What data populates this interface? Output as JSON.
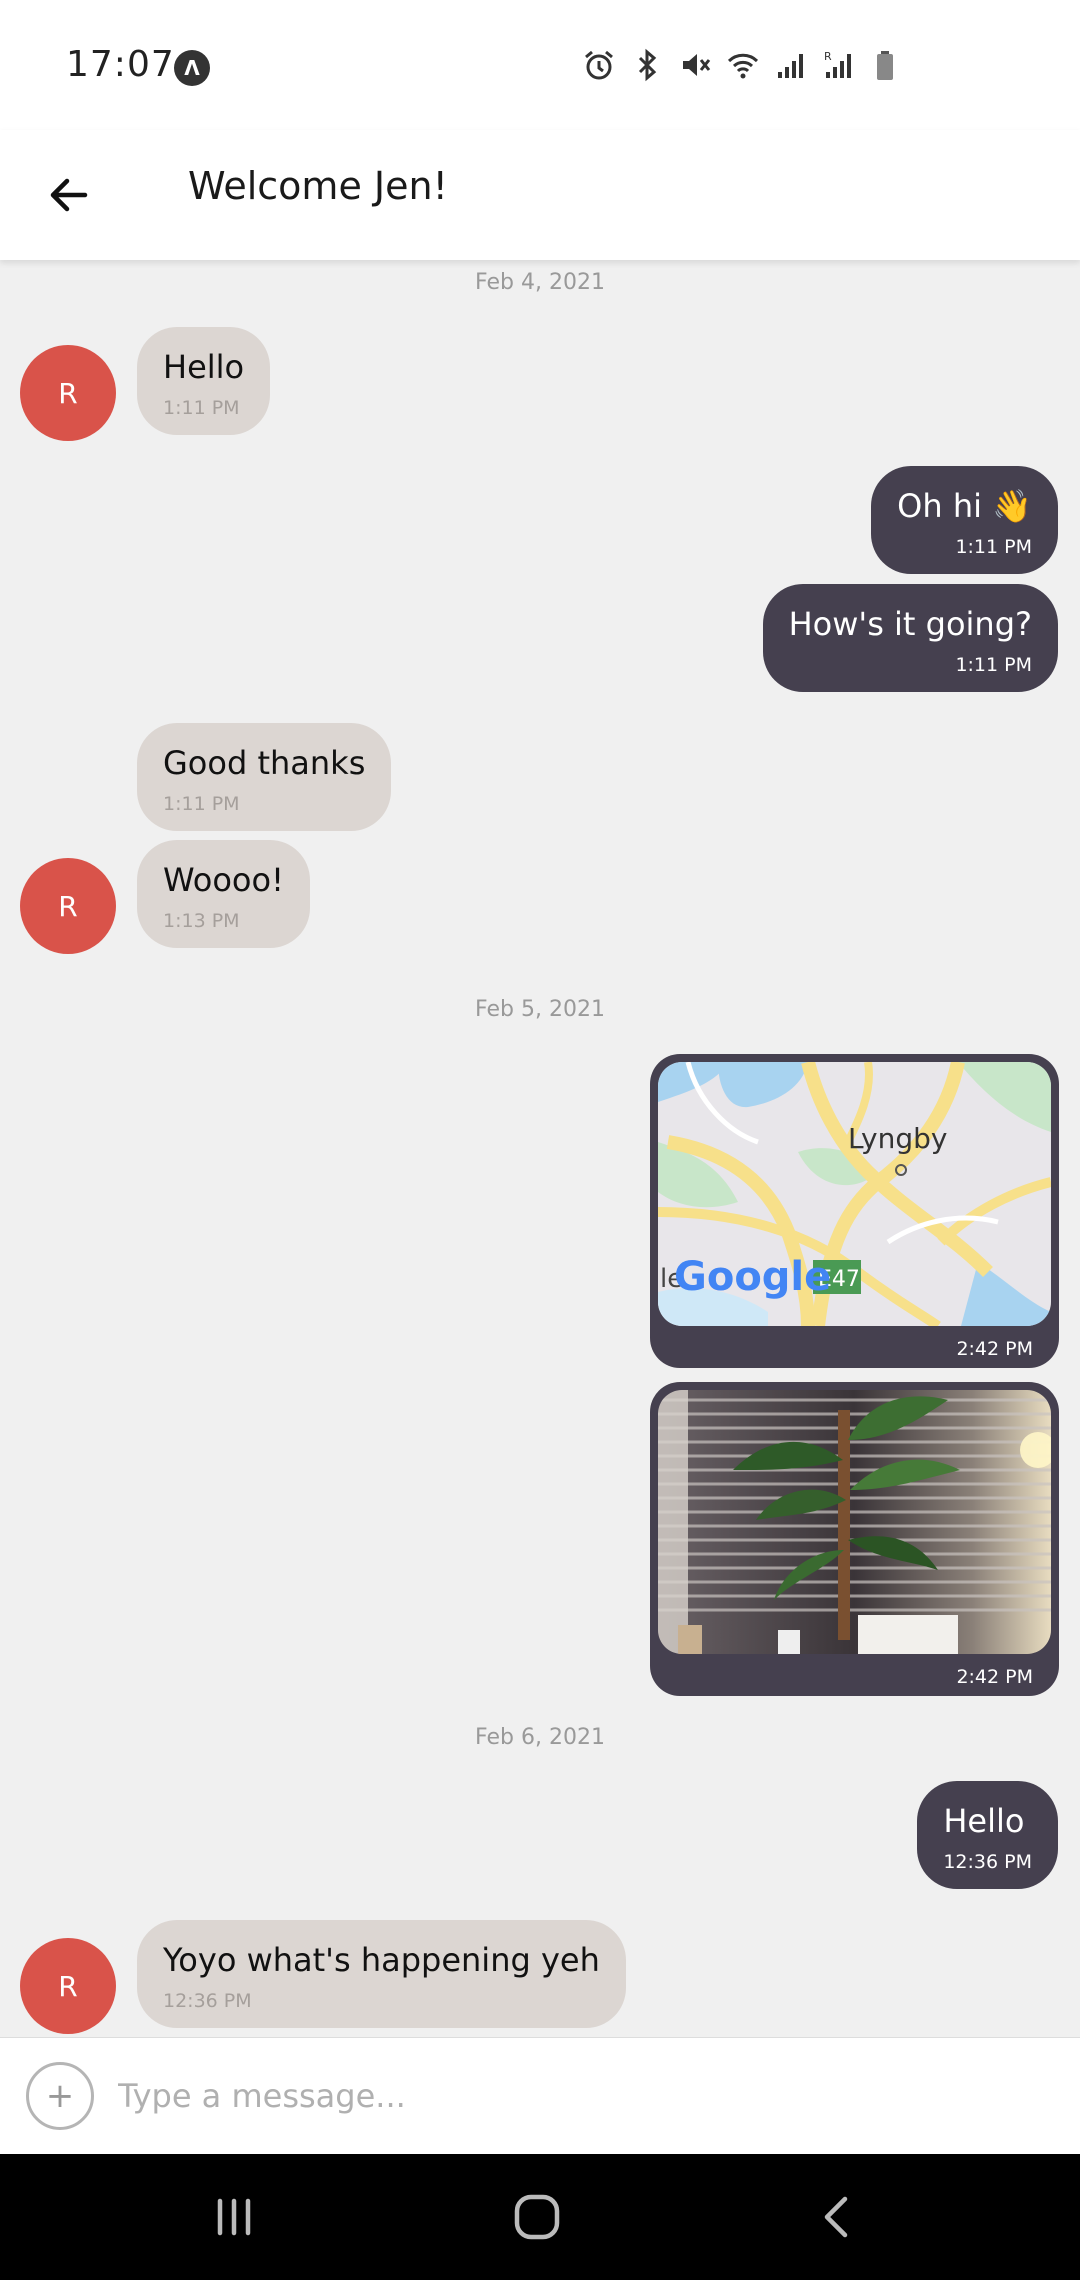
{
  "status_bar": {
    "time": "17:07",
    "badge": "Λ",
    "icons": [
      "alarm-icon",
      "bluetooth-icon",
      "mute-icon",
      "wifi-icon",
      "signal-icon",
      "signal-roaming-icon",
      "battery-icon"
    ]
  },
  "header": {
    "title": "Welcome Jen!",
    "back_icon": "arrow-left-icon"
  },
  "chat": {
    "date_separators": [
      "Feb 4, 2021",
      "Feb 5, 2021",
      "Feb 6, 2021"
    ],
    "avatar_initial": "R",
    "messages": [
      {
        "side": "in",
        "text": "Hello",
        "time": "1:11 PM"
      },
      {
        "side": "out",
        "text": "Oh hi 👋",
        "time": "1:11 PM"
      },
      {
        "side": "out",
        "text": "How's it going?",
        "time": "1:11 PM"
      },
      {
        "side": "in",
        "text": "Good thanks",
        "time": "1:11 PM"
      },
      {
        "side": "in",
        "text": "Woooo!",
        "time": "1:13 PM"
      },
      {
        "side": "out",
        "type": "map",
        "time": "2:42 PM",
        "map_place": "Lyngby",
        "map_road": "E47",
        "map_brand": "Google",
        "map_left_fragment": "le"
      },
      {
        "side": "out",
        "type": "image",
        "time": "2:42 PM"
      },
      {
        "side": "out",
        "text": "Hello",
        "time": "12:36 PM"
      },
      {
        "side": "in",
        "text": "Yoyo what's happening yeh",
        "time": "12:36 PM"
      }
    ]
  },
  "composer": {
    "add_icon": "plus-icon",
    "placeholder": "Type a message..."
  },
  "nav_bar": {
    "icons": [
      "recent-apps-icon",
      "home-icon",
      "back-icon"
    ]
  },
  "colors": {
    "incoming_bubble": "#dcd6d2",
    "outgoing_bubble": "#45404f",
    "avatar": "#d9534a",
    "background": "#f0f0f0"
  }
}
